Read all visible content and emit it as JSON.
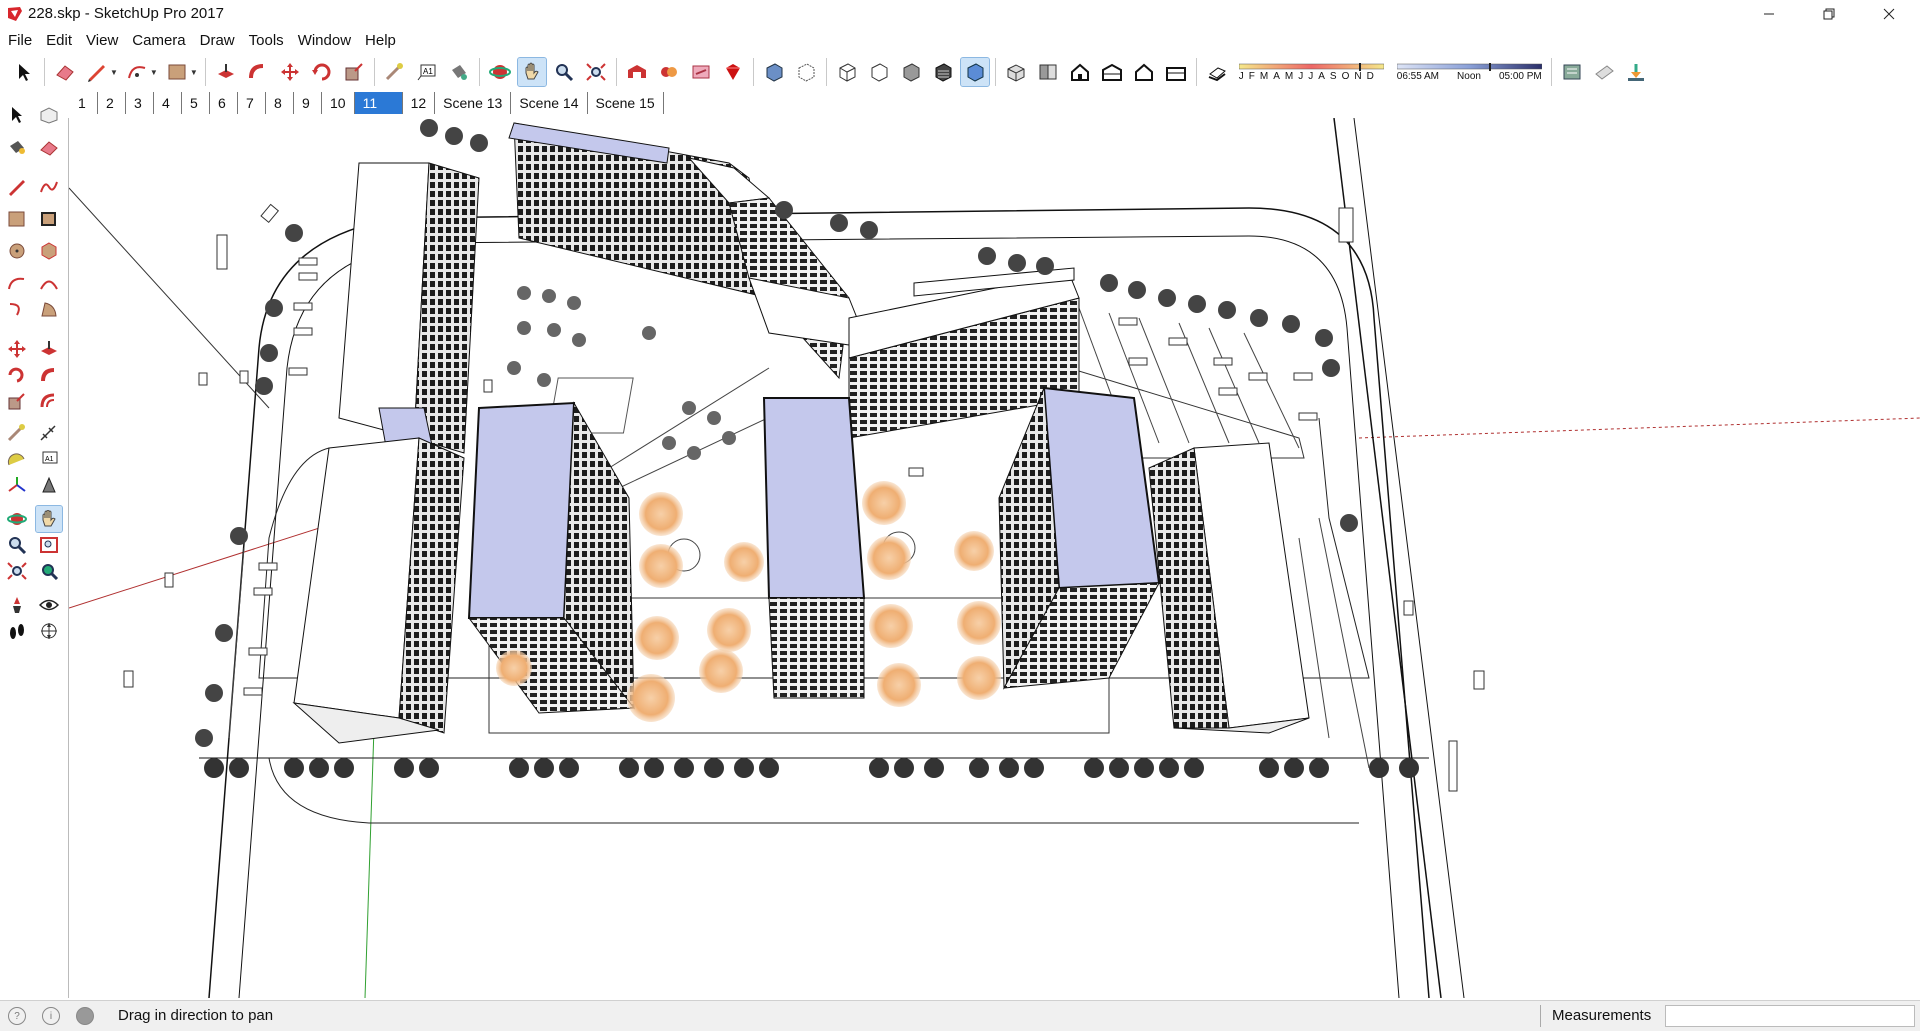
{
  "window": {
    "title": "228.skp - SketchUp Pro 2017",
    "controls": [
      "minimize",
      "restore",
      "close"
    ]
  },
  "menu": [
    "File",
    "Edit",
    "View",
    "Camera",
    "Draw",
    "Tools",
    "Window",
    "Help"
  ],
  "toolbar": {
    "icons": [
      "select-icon",
      "eraser-icon",
      "pencil-icon",
      "arc-icon",
      "rectangle-icon",
      "push-pull-icon",
      "follow-me-icon",
      "move-icon",
      "rotate-icon",
      "scale-icon",
      "tape-measure-icon",
      "text-icon",
      "paint-bucket-icon",
      "orbit-icon",
      "pan-icon",
      "zoom-icon",
      "zoom-extents-icon",
      "warehouse-icon",
      "extension-warehouse-icon",
      "share-model-icon",
      "ruby-icon",
      "xray-icon",
      "back-edges-icon",
      "wireframe-icon",
      "hidden-line-icon",
      "shaded-icon",
      "shaded-textures-icon",
      "monochrome-icon",
      "iso-view-icon",
      "top-view-icon",
      "front-view-icon",
      "right-view-icon",
      "back-view-icon",
      "left-view-icon",
      "shadows-toggle-icon",
      "layers-icon",
      "styles-icon",
      "geolocation-icon"
    ],
    "months": [
      "J",
      "F",
      "M",
      "A",
      "M",
      "J",
      "J",
      "A",
      "S",
      "O",
      "N",
      "D"
    ],
    "time_start": "06:55 AM",
    "time_mid": "Noon",
    "time_end": "05:00 PM"
  },
  "scenes": {
    "tabs": [
      "1",
      "2",
      "3",
      "4",
      "5",
      "6",
      "7",
      "8",
      "9",
      "10",
      "11",
      "12",
      "Scene 13",
      "Scene 14",
      "Scene 15"
    ],
    "active_index": 10
  },
  "left_tools": [
    "select-icon",
    "make-component-icon",
    "paint-bucket-icon",
    "eraser-icon",
    "line-icon",
    "freehand-icon",
    "rectangle-icon",
    "rotated-rectangle-icon",
    "circle-icon",
    "polygon-icon",
    "arc-icon",
    "pie-icon",
    "two-point-arc-icon",
    "three-point-arc-icon",
    "move-icon",
    "push-pull-icon",
    "rotate-icon",
    "follow-me-icon",
    "scale-icon",
    "offset-icon",
    "tape-measure-icon",
    "dimension-icon",
    "protractor-icon",
    "text-icon",
    "axes-icon",
    "3d-text-icon",
    "orbit-icon",
    "pan-icon",
    "zoom-icon",
    "zoom-window-icon",
    "zoom-extents-icon",
    "previous-view-icon",
    "position-camera-icon",
    "look-around-icon",
    "walk-icon",
    "section-plane-icon"
  ],
  "statusbar": {
    "icons": [
      "geo-info-icon",
      "credits-icon",
      "user-icon"
    ],
    "message": "Drag in direction to pan",
    "measurements_label": "Measurements",
    "measurements_value": ""
  },
  "colors": {
    "roof_blue": "#c4c8ec",
    "active_tab": "#2b79d6",
    "axis_red": "#b03030",
    "axis_green": "#30a030",
    "tree_orange": "#f0b070"
  }
}
